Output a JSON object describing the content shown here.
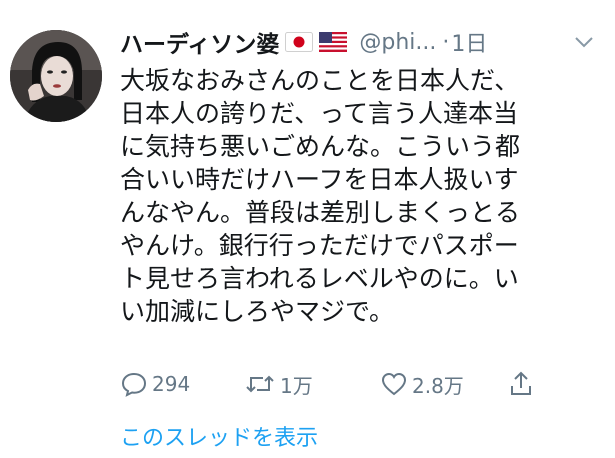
{
  "tweet": {
    "display_name": "ハーディソン婆",
    "handle": "@phi...",
    "separator": "·",
    "time": "1日",
    "flags": [
      "japan-flag",
      "us-flag"
    ],
    "lines": [
      "大坂なおみさんのことを日本人だ、",
      "日本人の誇りだ、って言う人達本当",
      "に気持ち悪いごめんな。こういう都",
      "合いい時だけハーフを日本人扱いす",
      "んなやん。普段は差別しまくっとる",
      "やんけ。銀行行っただけでパスポー",
      "ト見せろ言われるレベルやのに。い",
      "い加減にしろやマジで。"
    ],
    "actions": {
      "reply_count": "294",
      "retweet_count": "1万",
      "like_count": "2.8万"
    },
    "thread_link": "このスレッドを表示"
  },
  "colors": {
    "text": "#14171a",
    "secondary": "#657786",
    "link": "#1da1f2"
  }
}
